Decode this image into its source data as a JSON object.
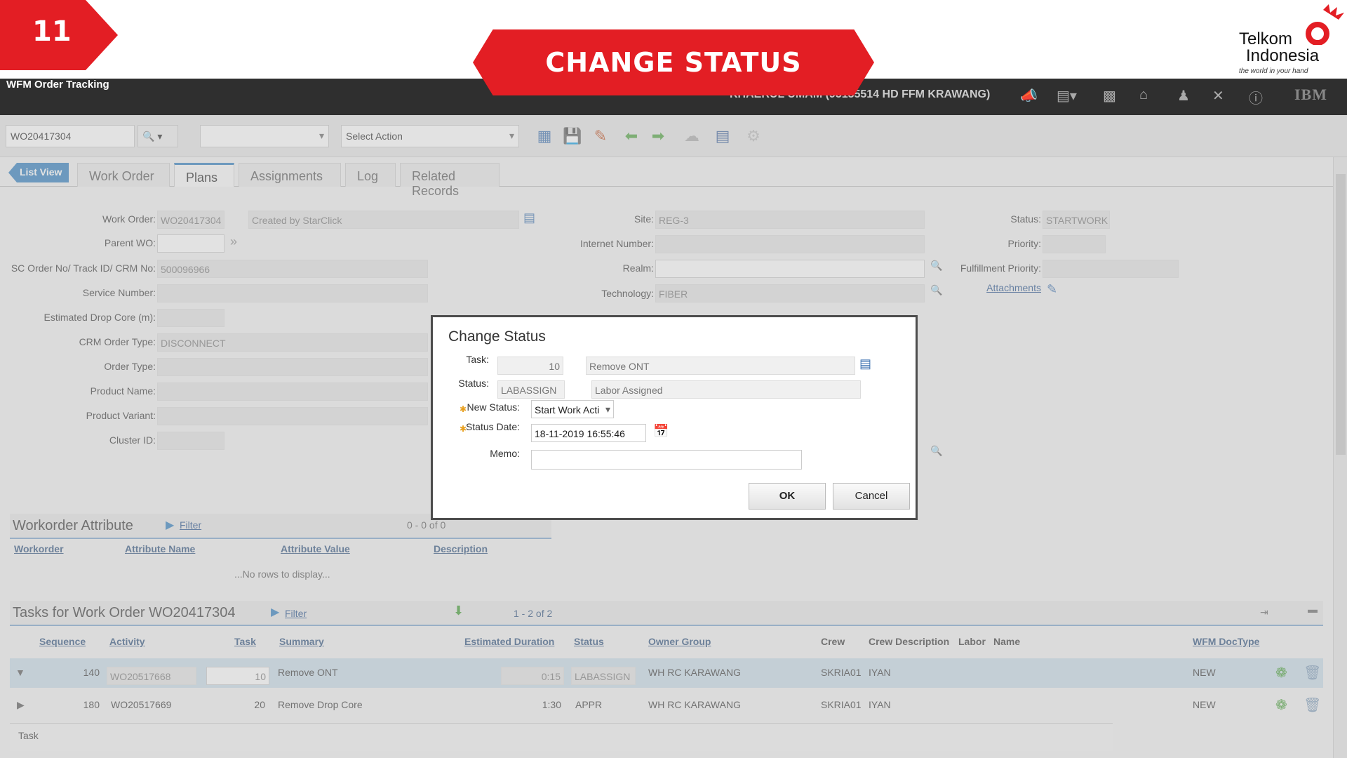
{
  "banner": {
    "step": "11",
    "title": "CHANGE STATUS"
  },
  "logo": {
    "line1": "Telkom",
    "line2": "Indonesia",
    "tagline": "the world in your hand"
  },
  "header": {
    "app_title": "WFM Order Tracking",
    "user": "KHAERUL UMAM (95155514 HD FFM KRAWANG)",
    "brand": "IBM"
  },
  "toolbar": {
    "record_id": "WO20417304",
    "query_select": "",
    "action_select": "Select Action"
  },
  "tabs": {
    "list_view": "List View",
    "items": [
      "Work Order",
      "Plans",
      "Assignments",
      "Log",
      "Related Records"
    ],
    "active": "Plans"
  },
  "form": {
    "work_order_label": "Work Order:",
    "work_order": "WO20417304",
    "description": "Created by StarClick",
    "parent_wo_label": "Parent WO:",
    "parent_wo": "",
    "sc_order_label": "SC Order No/ Track ID/ CRM No:",
    "sc_order": "500096966",
    "service_number_label": "Service Number:",
    "service_number": "",
    "drop_core_label": "Estimated Drop Core (m):",
    "drop_core": "",
    "crm_type_label": "CRM Order Type:",
    "crm_type": "DISCONNECT",
    "order_type_label": "Order Type:",
    "order_type": "",
    "product_name_label": "Product Name:",
    "product_name": "",
    "product_variant_label": "Product Variant:",
    "product_variant": "",
    "cluster_label": "Cluster ID:",
    "cluster": "",
    "site_label": "Site:",
    "site": "REG-3",
    "internet_label": "Internet Number:",
    "internet": "",
    "realm_label": "Realm:",
    "realm": "",
    "technology_label": "Technology:",
    "technology": "FIBER",
    "status_label": "Status:",
    "status": "STARTWORK",
    "priority_label": "Priority:",
    "priority": "",
    "fulfillment_label": "Fulfillment Priority:",
    "fulfillment": "",
    "attachments": "Attachments"
  },
  "attr_section": {
    "title": "Workorder Attribute",
    "filter": "Filter",
    "count": "0 - 0 of 0",
    "columns": [
      "Workorder",
      "Attribute Name",
      "Attribute Value",
      "Description"
    ],
    "empty": "...No rows to display..."
  },
  "tasks_section": {
    "title": "Tasks for Work Order WO20417304",
    "filter": "Filter",
    "count": "1 - 2 of 2",
    "columns": [
      "Sequence",
      "Activity",
      "Task",
      "Summary",
      "Estimated Duration",
      "Status",
      "Owner Group",
      "Crew",
      "Crew Description",
      "Labor",
      "Name",
      "WFM DocType"
    ],
    "rows": [
      {
        "sequence": "140",
        "activity": "WO20517668",
        "task": "10",
        "summary": "Remove ONT",
        "duration": "0:15",
        "status": "LABASSIGN",
        "owner_group": "WH RC KARAWANG",
        "crew": "SKRIA01",
        "crew_desc": "IYAN",
        "doctype": "NEW"
      },
      {
        "sequence": "180",
        "activity": "WO20517669",
        "task": "20",
        "summary": "Remove Drop Core",
        "duration": "1:30",
        "status": "APPR",
        "owner_group": "WH RC KARAWANG",
        "crew": "SKRIA01",
        "crew_desc": "IYAN",
        "doctype": "NEW"
      }
    ],
    "footer": "Task"
  },
  "dialog": {
    "title": "Change Status",
    "task_label": "Task:",
    "task_num": "10",
    "task_desc": "Remove ONT",
    "status_label": "Status:",
    "status_code": "LABASSIGN",
    "status_desc": "Labor Assigned",
    "new_status_label": "New Status:",
    "new_status": "Start Work Acti",
    "status_date_label": "Status Date:",
    "status_date": "18-11-2019 16:55:46",
    "memo_label": "Memo:",
    "memo": "",
    "ok": "OK",
    "cancel": "Cancel"
  },
  "colors": {
    "accent_red": "#e31e24",
    "header_dark": "#2f2f2f",
    "link_blue": "#2a7bbd"
  }
}
